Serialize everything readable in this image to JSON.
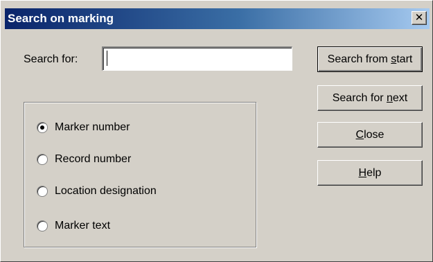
{
  "dialog": {
    "title": "Search on marking",
    "close_glyph": "✕"
  },
  "search": {
    "label": "Search for:",
    "value": "",
    "placeholder": ""
  },
  "options": {
    "selected": "Marker number",
    "items": [
      {
        "label": "Marker number",
        "checked": true
      },
      {
        "label": "Record number",
        "checked": false
      },
      {
        "label": "Location designation",
        "checked": false
      },
      {
        "label": "Marker text",
        "checked": false
      }
    ]
  },
  "buttons": {
    "search_from_start": {
      "label": "Search from start",
      "access_key": "s"
    },
    "search_for_next": {
      "label": "Search for next",
      "access_key": "n"
    },
    "close": {
      "label": "Close",
      "access_key": "C"
    },
    "help": {
      "label": "Help",
      "access_key": "H"
    }
  },
  "colors": {
    "face": "#d4d0c8",
    "title_start": "#0a246a",
    "title_end": "#a6caf0"
  }
}
